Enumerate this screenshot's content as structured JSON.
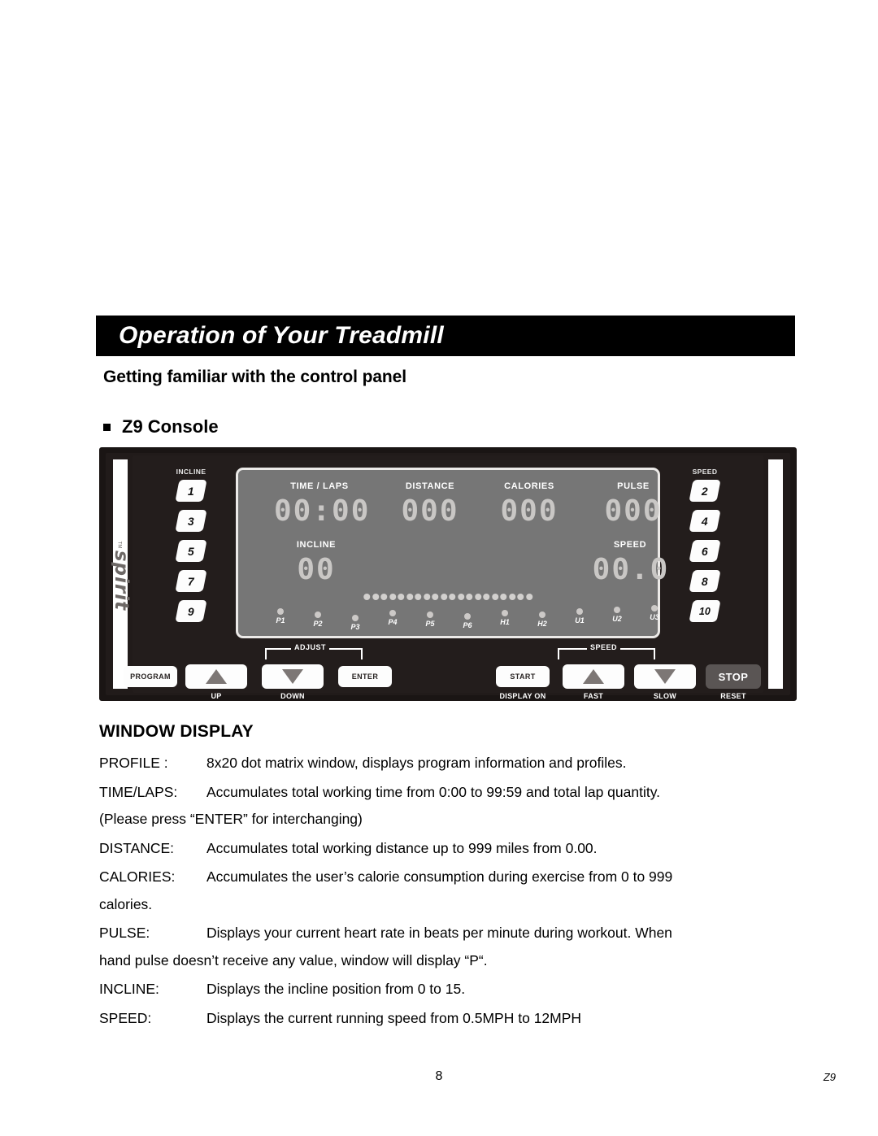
{
  "header": {
    "title": "Operation of Your Treadmill",
    "subtitle": "Getting familiar with the control panel",
    "bullet_label": "Z9 Console"
  },
  "console": {
    "brand": "spirit",
    "brand_tm": "TM",
    "incline_column_label": "INCLINE",
    "speed_column_label": "SPEED",
    "incline_buttons": [
      "1",
      "3",
      "5",
      "7",
      "9"
    ],
    "speed_buttons": [
      "2",
      "4",
      "6",
      "8",
      "10"
    ],
    "lcd": {
      "fields": [
        {
          "label": "TIME / LAPS",
          "value": "00:00"
        },
        {
          "label": "DISTANCE",
          "value": "000"
        },
        {
          "label": "CALORIES",
          "value": "000"
        },
        {
          "label": "PULSE",
          "value": "000"
        },
        {
          "label": "INCLINE",
          "value": "00"
        },
        {
          "label": "SPEED",
          "value": "00.0"
        }
      ],
      "dot_matrix_count": 20,
      "leds": [
        "P1",
        "P2",
        "P3",
        "P4",
        "P5",
        "P6",
        "H1",
        "H2",
        "U1",
        "U2",
        "U3"
      ]
    },
    "controls": {
      "adjust_bracket": "ADJUST",
      "speed_bracket": "SPEED",
      "program": "PROGRAM",
      "up_sublabel": "UP",
      "down_sublabel": "DOWN",
      "enter": "ENTER",
      "start": "START",
      "start_sublabel": "DISPLAY ON",
      "fast_sublabel": "FAST",
      "slow_sublabel": "SLOW",
      "stop": "STOP",
      "stop_sublabel": "RESET"
    },
    "colors": {
      "shell": "#1a1514",
      "panel": "#231d1c",
      "lcd_bg": "#767676",
      "lcd_border": "#eceae8",
      "segment": "#c9c7c5",
      "button_face": "#fdfdfd",
      "stop_button": "#5a5554"
    }
  },
  "window_display": {
    "heading": "WINDOW DISPLAY",
    "entries": [
      {
        "term": "PROFILE :",
        "desc": "8x20 dot matrix window, displays program information and profiles.",
        "cont": ""
      },
      {
        "term": "TIME/LAPS:",
        "desc": "Accumulates total working time from 0:00 to 99:59 and total lap quantity.",
        "cont": "(Please press “ENTER” for interchanging)"
      },
      {
        "term": "DISTANCE:",
        "desc": "Accumulates total working distance up to 999 miles from 0.00.",
        "cont": ""
      },
      {
        "term": "CALORIES:",
        "desc": "Accumulates the user’s calorie consumption during exercise from 0 to 999",
        "cont": "calories."
      },
      {
        "term": "PULSE:",
        "desc": "Displays your current heart rate in beats per minute during workout. When",
        "cont": "hand pulse doesn’t receive any value, window will display “P“."
      },
      {
        "term": "INCLINE:",
        "desc": "Displays the incline position from 0 to 15.",
        "cont": ""
      },
      {
        "term": "SPEED:",
        "desc": "Displays the current running speed from 0.5MPH to 12MPH",
        "cont": ""
      }
    ]
  },
  "footer": {
    "page_number": "8",
    "model": "Z9"
  }
}
